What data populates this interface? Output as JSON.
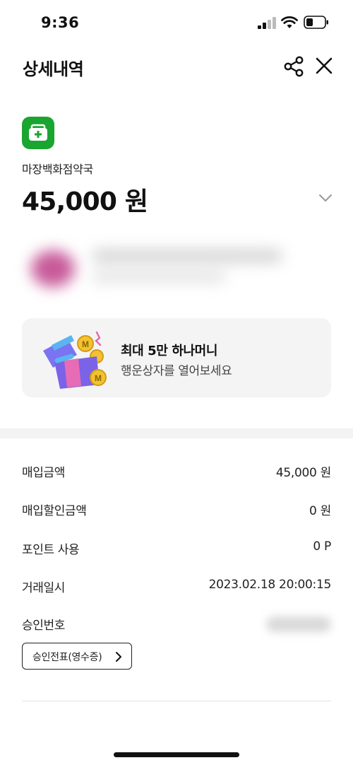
{
  "status_bar": {
    "time": "9:36"
  },
  "header": {
    "title": "상세내역"
  },
  "merchant": {
    "name": "마장백화점약국",
    "amount": "45,000 원",
    "icon_color": "#1aa531"
  },
  "promo": {
    "line1": "최대 5만 하나머니",
    "line2": "행운상자를 열어보세요"
  },
  "details": {
    "purchase_amount": {
      "label": "매입금액",
      "value": "45,000 원"
    },
    "discount_amount": {
      "label": "매입할인금액",
      "value": "0 원"
    },
    "points_used": {
      "label": "포인트 사용",
      "value": "0 P"
    },
    "transaction_time": {
      "label": "거래일시",
      "value": "2023.02.18 20:00:15"
    },
    "approval_number": {
      "label": "승인번호"
    }
  },
  "receipt_button": {
    "label": "승인전표(영수증)"
  }
}
